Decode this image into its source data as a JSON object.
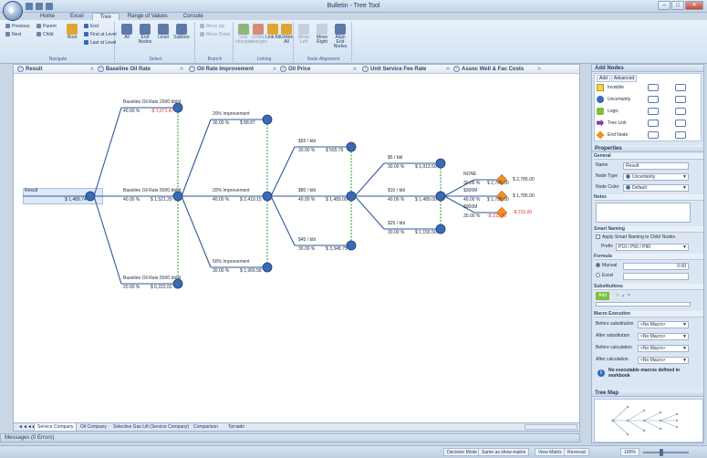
{
  "window": {
    "title": "Bulletin - Tree Tool",
    "buttons": [
      "–",
      "□",
      "✕"
    ]
  },
  "menu_tabs": [
    "Home",
    "Excel",
    "Tree",
    "Range of Values",
    "Console"
  ],
  "ribbon": {
    "navigate": {
      "label": "Navigate",
      "previous": "Previous",
      "next": "Next",
      "parent": "Parent",
      "child": "Child",
      "root": "Root",
      "end": "End",
      "first_at_level": "First at Level",
      "last_at_level": "Last at Level"
    },
    "select": {
      "label": "Select",
      "all": "All",
      "end_nodes": "End Nodes",
      "level": "Level",
      "subtree": "Subtree"
    },
    "branch": {
      "label": "Branch",
      "move_up": "Move Up",
      "move_down": "Move Down"
    },
    "linking": {
      "label": "Linking",
      "link_changes": "Link changes",
      "unlink_changes": "Unlink changes",
      "link_all": "Link All",
      "unlink_all": "Unlink All"
    },
    "alignment": {
      "label": "Node Alignment",
      "move_left": "Move Left",
      "move_right": "Move Right",
      "align_end": "Align End Nodes"
    }
  },
  "column_headers": [
    "Result",
    "Baseline Oil Rate",
    "Oil Rate Improvement",
    "Oil Price",
    "Unit Service Fee Rate",
    "Assoc Well & Fac Costs"
  ],
  "tree": {
    "root": {
      "label": "Result",
      "value": "$ 1,489.74"
    },
    "baseline": [
      {
        "label": "Baseline Oil Rate 2000 bbl/d",
        "prob": "40.00 %",
        "value": "-$ 1,671.47"
      },
      {
        "label": "Baseline Oil Rate 5000 bbl/d",
        "prob": "40.00 %",
        "value": "$ 1,521.29"
      },
      {
        "label": "Baseline Oil Rate 5000 bbl/d",
        "prob": "20.00 %",
        "value": "$ 6,222.02"
      }
    ],
    "improvement": [
      {
        "label": "20% Improvement",
        "prob": "30.00 %",
        "value": "$ 88.87"
      },
      {
        "label": "20% Improvement",
        "prob": "40.00 %",
        "value": "$ 2,419.15"
      },
      {
        "label": "50% Improvement",
        "prob": "30.00 %",
        "value": "$ 1,966.58"
      }
    ],
    "price": [
      {
        "label": "$55 / bbl",
        "prob": "30.00 %",
        "value": "$ 565.75"
      },
      {
        "label": "$80 / bbl",
        "prob": "40.00 %",
        "value": "$ 1,489.00"
      },
      {
        "label": "$45 / bbl",
        "prob": "30.00 %",
        "value": "$ 3,348.75"
      }
    ],
    "fee": [
      {
        "label": "$5 / bbl",
        "prob": "30.00 %",
        "value": "$ 1,913.50"
      },
      {
        "label": "$10 / bbl",
        "prob": "40.00 %",
        "value": "$ 1,489.00"
      },
      {
        "label": "$25 / bbl",
        "prob": "30.00 %",
        "value": "$ 1,156.50"
      }
    ],
    "costs": [
      {
        "label": "NONE",
        "prob": "30.00 %",
        "value": "$ 2,785.00",
        "end": "$ 2,785.00"
      },
      {
        "label": "$300M",
        "prob": "40.00 %",
        "value": "$ 1,785.00",
        "end": "$ 1,785.00"
      },
      {
        "label": "$900M",
        "prob": "30.00 %",
        "value": "-$ 215.00",
        "end": "-$ 215.00"
      }
    ]
  },
  "sheet_tabs": [
    "Service Company",
    "Oil Company",
    "Selective Gas Lift (Service Company)",
    "Comparison",
    "Tornado"
  ],
  "message_bar": "Messages (0 Errors)",
  "status_bar": {
    "items": [
      "Decision Mode",
      "Same as show-matrix",
      "View Matrix",
      "Reversal"
    ],
    "zoom": "100%"
  },
  "add_nodes": {
    "title": "Add Nodes",
    "tabs": [
      "Add",
      "Advanced"
    ],
    "types": [
      {
        "label": "Invisible",
        "color": "#f2d64b"
      },
      {
        "label": "Uncertainty",
        "color": "#3a69b8"
      },
      {
        "label": "Logic",
        "color": "#7bbf3f"
      },
      {
        "label": "Tree Link",
        "color": "#7a3fa0"
      },
      {
        "label": "End Node",
        "color": "#f29022"
      }
    ]
  },
  "properties": {
    "title": "Properties",
    "general": "General",
    "name_label": "Name",
    "name_value": "Result",
    "type_label": "Node Type",
    "type_value": "Uncertainty",
    "color_label": "Node Color",
    "color_value": "Default",
    "notes": "Notes",
    "smart_naming": "Smart Naming",
    "apply_smart": "Apply Smart Naming to Child Nodes",
    "prefix_label": "Prefix",
    "prefix_value": "P10 / P50 / P90",
    "formula": "Formula",
    "manual_label": "Manual",
    "manual_value": "0.00",
    "excel_label": "Excel",
    "substitutions": "Substitutions",
    "add_label": "Add",
    "macro": "Macro Execution",
    "before_sub": "Before substitution",
    "after_sub": "After substitution",
    "before_calc": "Before calculation",
    "after_calc": "After calculation",
    "no_macro": "<No Macro>",
    "macro_info": "No executable macros defined in workbook",
    "tree_map": "Tree Map"
  },
  "colors": {
    "uncertainty": "#3a69b8",
    "end": "#f29022",
    "link": "#2f5a9a",
    "negative": "#d43a24"
  }
}
